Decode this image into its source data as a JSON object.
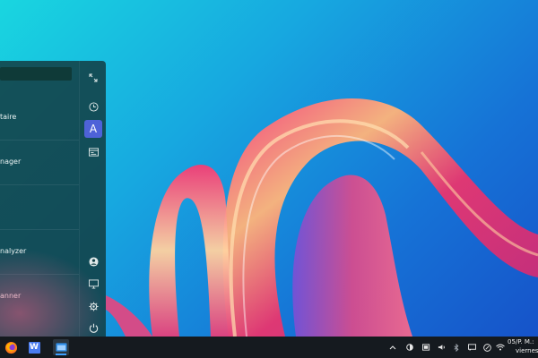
{
  "start_menu": {
    "search_value": "",
    "apps": [
      {
        "label": "taire"
      },
      {
        "label": "nager"
      },
      {
        "label": ""
      },
      {
        "label": "nalyzer"
      },
      {
        "label": "anner"
      }
    ],
    "side_icons": [
      "expand-icon",
      "recent-icon",
      "all-apps-icon",
      "store-icon",
      "user-icon",
      "display-icon",
      "settings-icon",
      "power-icon"
    ],
    "all_apps_glyph": "A"
  },
  "taskbar": {
    "apps": [
      "firefox-icon",
      "writer-icon",
      "file-manager-icon"
    ],
    "writer_glyph": "W",
    "tray_icons": [
      "chevron-up-icon",
      "night-mode-icon",
      "battery-icon",
      "bluetooth-icon",
      "notification-icon",
      "clipboard-icon",
      "wifi-icon"
    ],
    "clock": {
      "time": "05/P. M.:",
      "day": "viernes"
    }
  },
  "colors": {
    "accent": "#4e62d8",
    "taskbar": "#151a1f",
    "menu_bg": "#124046"
  }
}
